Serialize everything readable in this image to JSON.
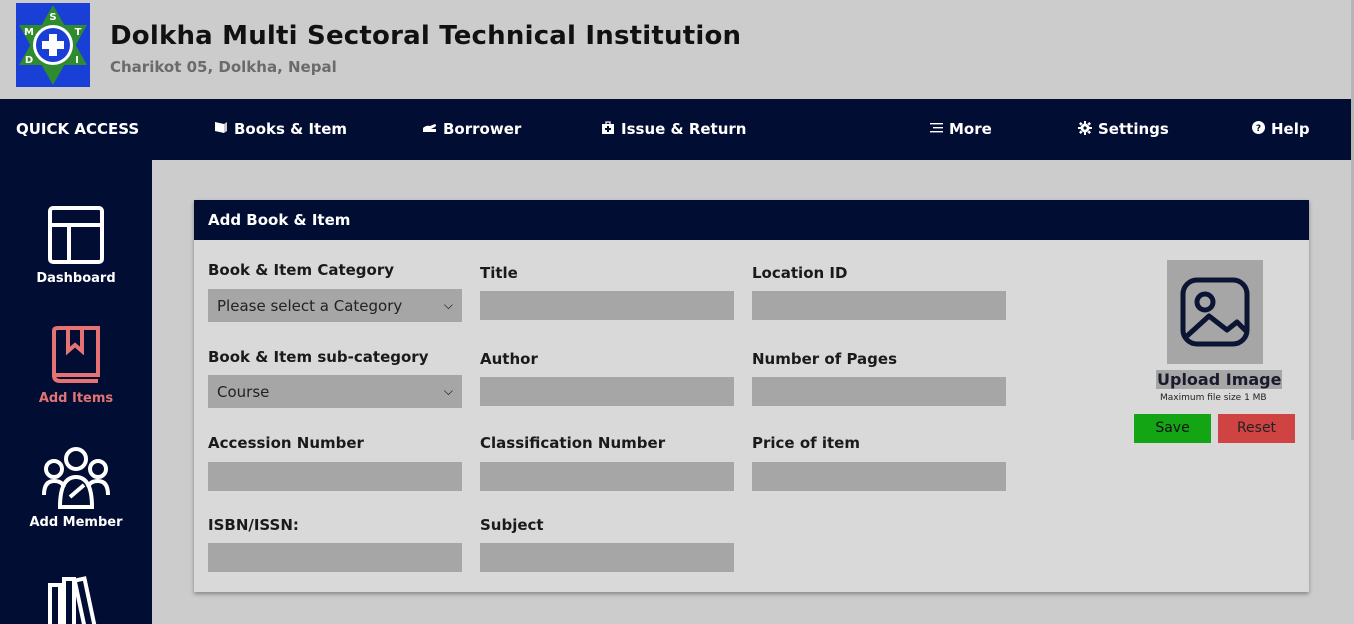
{
  "header": {
    "logo_letters": [
      "M",
      "S",
      "T",
      "D",
      "I"
    ],
    "institution_name": "Dolkha Multi Sectoral Technical Institution",
    "address": "Charikot 05, Dolkha, Nepal"
  },
  "nav": {
    "quick_access": "QUICK ACCESS",
    "items": [
      {
        "label": "Books & Item",
        "icon": "book-icon"
      },
      {
        "label": "Borrower",
        "icon": "hand-icon"
      },
      {
        "label": "Issue & Return",
        "icon": "medkit-icon"
      },
      {
        "label": "More",
        "icon": "list-icon"
      },
      {
        "label": "Settings",
        "icon": "gear-icon"
      },
      {
        "label": "Help",
        "icon": "question-icon"
      }
    ]
  },
  "sidebar": {
    "items": [
      {
        "label": "Dashboard",
        "icon": "dashboard-icon"
      },
      {
        "label": "Add Items",
        "icon": "bookmark-book-icon",
        "active": true
      },
      {
        "label": "Add Member",
        "icon": "users-icon"
      },
      {
        "label": "",
        "icon": "books-icon"
      }
    ]
  },
  "form": {
    "title": "Add Book & Item",
    "category_label": "Book & Item Category",
    "category_value": "Please select a Category",
    "subcategory_label": "Book & Item sub-category",
    "subcategory_value": "Course",
    "accession_label": "Accession Number",
    "isbn_label": "ISBN/ISSN:",
    "title_label": "Title",
    "author_label": "Author",
    "classification_label": "Classification Number",
    "subject_label": "Subject",
    "location_label": "Location ID",
    "pages_label": "Number of Pages",
    "price_label": "Price of item",
    "upload_label": "Upload Image",
    "upload_note": "Maximum file size 1 MB",
    "save_label": "Save",
    "reset_label": "Reset"
  },
  "colors": {
    "nav_bg": "#020d33",
    "page_bg": "#cccccc",
    "input_bg": "#a6a6a6",
    "save": "#14a514",
    "reset": "#cf4343",
    "active_sidebar": "#e57373"
  }
}
